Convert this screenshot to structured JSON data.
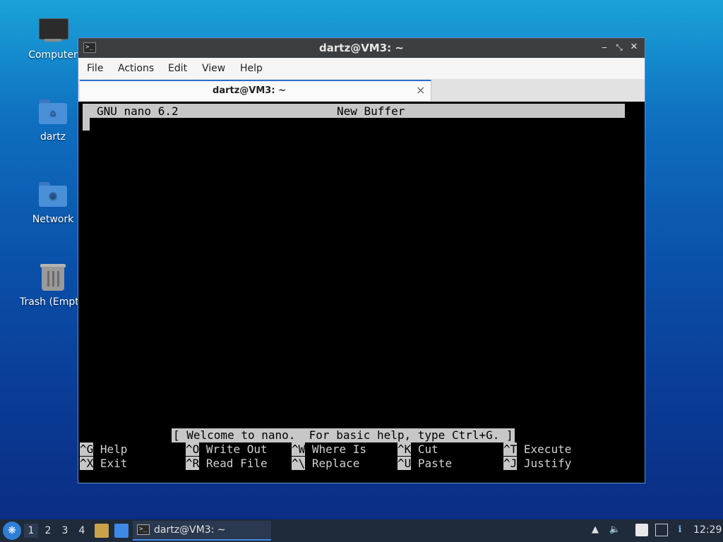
{
  "desktop": {
    "icons": [
      {
        "label": "Computer",
        "icon": "computer-icon"
      },
      {
        "label": "dartz",
        "icon": "home-folder-icon"
      },
      {
        "label": "Network",
        "icon": "network-folder-icon"
      },
      {
        "label": "Trash (Empty)",
        "icon": "trash-icon"
      }
    ]
  },
  "window": {
    "title": "dartz@VM3: ~",
    "menu": [
      "File",
      "Actions",
      "Edit",
      "View",
      "Help"
    ],
    "tab_label": "dartz@VM3: ~",
    "controls": {
      "minimize": "‒",
      "maximize": "⤡",
      "close": "✕"
    }
  },
  "nano": {
    "version": "GNU nano 6.2",
    "buffer": "New Buffer",
    "status": "[ Welcome to nano.  For basic help, type Ctrl+G. ]",
    "shortcuts_row1": [
      {
        "key": "^G",
        "label": "Help"
      },
      {
        "key": "^O",
        "label": "Write Out"
      },
      {
        "key": "^W",
        "label": "Where Is"
      },
      {
        "key": "^K",
        "label": "Cut"
      },
      {
        "key": "^T",
        "label": "Execute"
      }
    ],
    "shortcuts_row2": [
      {
        "key": "^X",
        "label": "Exit"
      },
      {
        "key": "^R",
        "label": "Read File"
      },
      {
        "key": "^\\",
        "label": "Replace"
      },
      {
        "key": "^U",
        "label": "Paste"
      },
      {
        "key": "^J",
        "label": "Justify"
      }
    ]
  },
  "taskbar": {
    "workspaces": [
      "1",
      "2",
      "3",
      "4"
    ],
    "active_workspace": "1",
    "task_label": "dartz@VM3: ~",
    "clock": "12:29",
    "accent": "#3f88e6"
  }
}
